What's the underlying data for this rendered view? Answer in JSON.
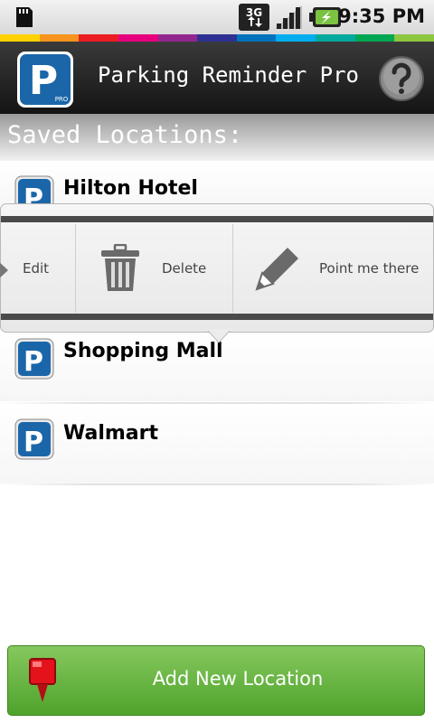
{
  "status_bar": {
    "network_label": "3G",
    "time": "9:35 PM"
  },
  "app_bar": {
    "title": "Parking Reminder Pro",
    "logo_letter": "P",
    "logo_badge": "PRO"
  },
  "section_title": "Saved Locations:",
  "locations": [
    {
      "name": "Hilton Hotel"
    },
    {
      "name": "Shopping Mall"
    },
    {
      "name": "Walmart"
    }
  ],
  "quick_actions": [
    {
      "label": "Edit"
    },
    {
      "label": "Delete"
    },
    {
      "label": "Point me there"
    }
  ],
  "add_button": {
    "label": "Add New Location"
  },
  "colors": {
    "rainbow": [
      "#ffd200",
      "#f7941d",
      "#ed1c24",
      "#e6007e",
      "#92278f",
      "#2e3192",
      "#0072bc",
      "#00aeef",
      "#00a99d",
      "#00a651",
      "#8dc63f"
    ],
    "brand_blue": "#1b66a8",
    "button_green": "#5cb337"
  },
  "icons": {
    "help": "question-mark-icon",
    "delete": "trash-icon",
    "point": "pencil-icon",
    "edit": "edit-arrow-icon",
    "add": "map-pin-icon"
  }
}
